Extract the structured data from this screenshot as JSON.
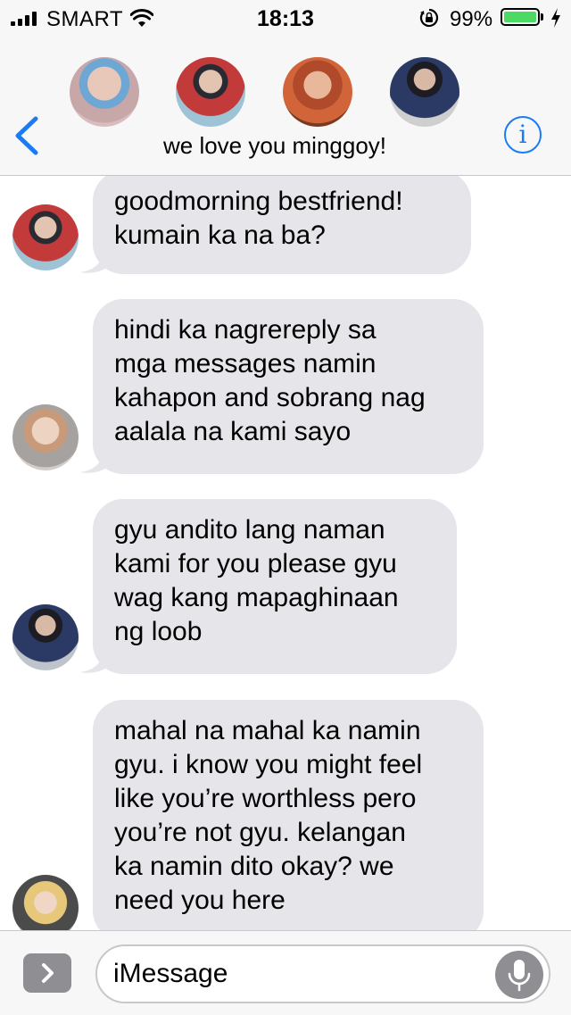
{
  "status_bar": {
    "carrier": "SMART",
    "time": "18:13",
    "battery_percent": "99%",
    "battery_level": 0.99,
    "battery_color": "#4cd964"
  },
  "header": {
    "group_name": "we love you minggoy!",
    "info_icon_glyph": "i",
    "accent_color": "#1a7cf5",
    "back_icon": "chevron-left-icon"
  },
  "messages": [
    {
      "lines": [
        "goodmorning bestfriend!",
        "kumain ka na ba?"
      ]
    },
    {
      "lines": [
        "hindi ka nagrereply sa",
        "mga messages namin",
        "kahapon and sobrang nag",
        "aalala na kami sayo"
      ]
    },
    {
      "lines": [
        "gyu andito lang naman",
        "kami for you please gyu",
        "wag kang mapaghinaan",
        "ng loob"
      ]
    },
    {
      "lines": [
        "mahal na mahal ka namin",
        "gyu. i know you might feel",
        "like you’re worthless pero",
        "you’re not gyu. kelangan",
        "ka namin dito okay? we",
        "need you here"
      ]
    }
  ],
  "input_bar": {
    "placeholder": "iMessage",
    "value": ""
  }
}
